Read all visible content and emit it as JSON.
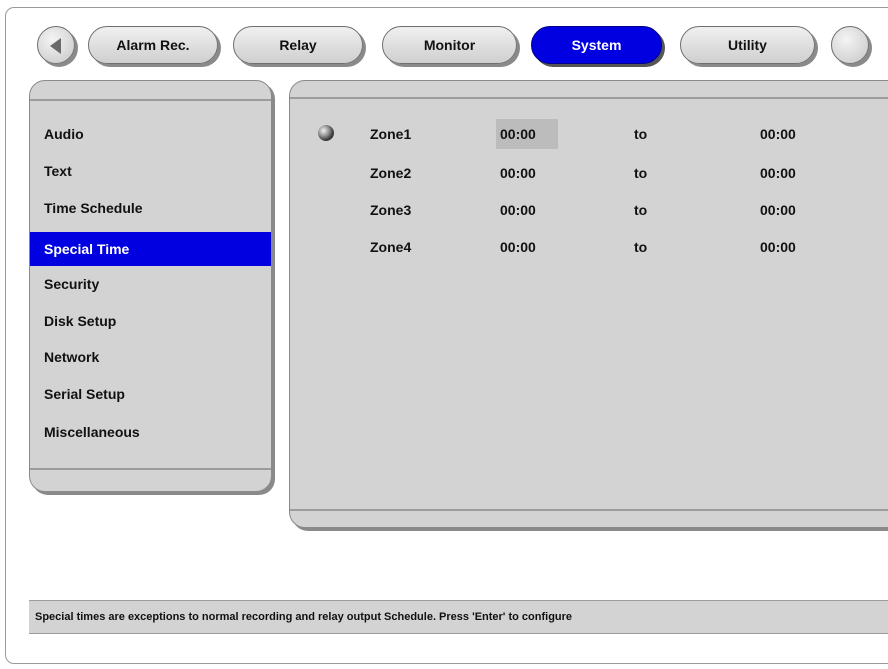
{
  "tabs": [
    {
      "label": "Alarm Rec.",
      "active": false
    },
    {
      "label": "Relay",
      "active": false
    },
    {
      "label": "Monitor",
      "active": false
    },
    {
      "label": "System",
      "active": true
    },
    {
      "label": "Utility",
      "active": false
    }
  ],
  "menu": {
    "items": [
      {
        "label": "Audio"
      },
      {
        "label": "Text"
      },
      {
        "label": "Time Schedule"
      },
      {
        "label": "Special Time",
        "active": true
      },
      {
        "label": "Security"
      },
      {
        "label": "Disk Setup"
      },
      {
        "label": "Network"
      },
      {
        "label": "Serial Setup"
      },
      {
        "label": "Miscellaneous"
      }
    ]
  },
  "zones": [
    {
      "name": "Zone1",
      "start": "00:00",
      "sep": "to",
      "end": "00:00"
    },
    {
      "name": "Zone2",
      "start": "00:00",
      "sep": "to",
      "end": "00:00"
    },
    {
      "name": "Zone3",
      "start": "00:00",
      "sep": "to",
      "end": "00:00"
    },
    {
      "name": "Zone4",
      "start": "00:00",
      "sep": "to",
      "end": "00:00"
    }
  ],
  "status": {
    "text": "Special times are exceptions to normal recording and relay output Schedule. Press 'Enter' to configure"
  },
  "colors": {
    "accent": "#0000e0",
    "panel": "#d3d3d3"
  }
}
